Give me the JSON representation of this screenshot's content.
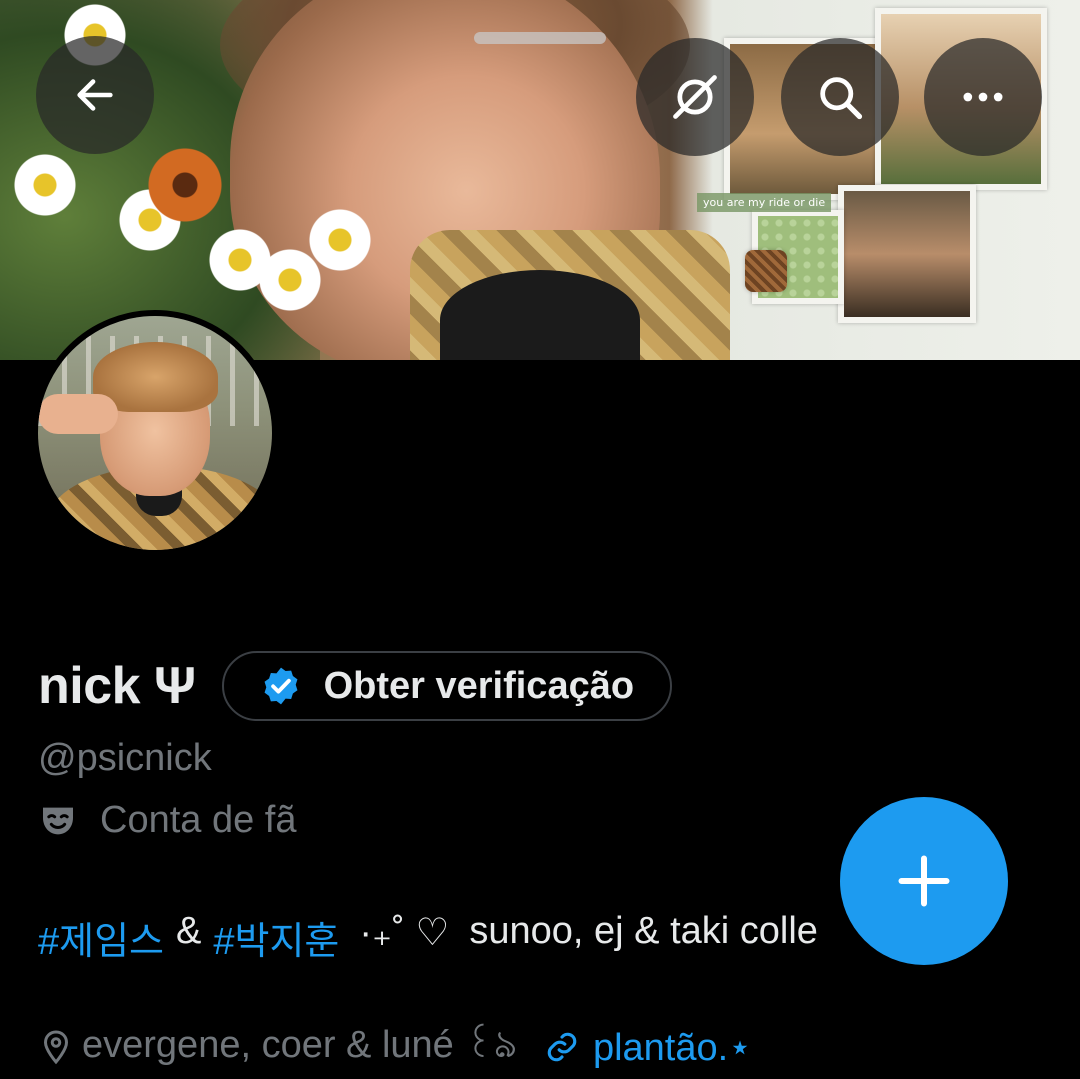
{
  "banner": {
    "collage_caption": "you are my ride or die"
  },
  "controls": {
    "back_icon": "arrow-left-icon",
    "satellite_icon": "satellite-off-icon",
    "search_icon": "search-icon",
    "more_icon": "more-horizontal-icon"
  },
  "profile": {
    "display_name": "nick Ψ",
    "verify_label": "Obter verificação",
    "handle": "@psicnick",
    "category": "Conta de fã",
    "bio": {
      "tag1": "#제임스",
      "amp": "&",
      "tag2": "#박지훈",
      "deco": "·₊˚ ♡",
      "text": "sunoo, ej & taki colle"
    },
    "location": "evergene, coer & luné ꒰ঌ",
    "link": "plantão.⋆"
  },
  "colors": {
    "accent": "#1d9bf0",
    "muted": "#71767b",
    "text": "#e7e9ea",
    "background": "#000000"
  }
}
